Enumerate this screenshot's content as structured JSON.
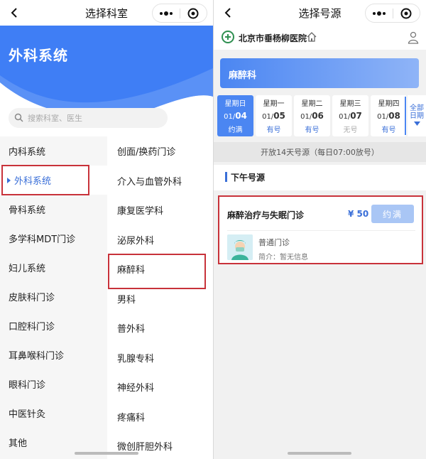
{
  "left": {
    "nav_title": "选择科室",
    "hero_title": "外科系统",
    "search_placeholder": "搜索科室、医生",
    "categories": [
      "内科系统",
      "外科系统",
      "骨科系统",
      "多学科MDT门诊",
      "妇儿系统",
      "皮肤科门诊",
      "口腔科门诊",
      "耳鼻喉科门诊",
      "眼科门诊",
      "中医针灸",
      "其他"
    ],
    "subdepartments": [
      "创面/换药门诊",
      "介入与血管外科",
      "康复医学科",
      "泌尿外科",
      "麻醉科",
      "男科",
      "普外科",
      "乳腺专科",
      "神经外科",
      "疼痛科",
      "微创肝胆外科"
    ]
  },
  "right": {
    "nav_title": "选择号源",
    "hospital_name": "北京市垂杨柳医院",
    "dept_name": "麻醉科",
    "dates": [
      {
        "weekday": "星期日",
        "month": "01/",
        "day": "04",
        "status": "约满"
      },
      {
        "weekday": "星期一",
        "month": "01/",
        "day": "05",
        "status": "有号"
      },
      {
        "weekday": "星期二",
        "month": "01/",
        "day": "06",
        "status": "有号"
      },
      {
        "weekday": "星期三",
        "month": "01/",
        "day": "07",
        "status": "无号"
      },
      {
        "weekday": "星期四",
        "month": "01/",
        "day": "08",
        "status": "有号"
      }
    ],
    "all_dates_label_1": "全部",
    "all_dates_label_2": "日期",
    "notice": "开放14天号源（每日07:00放号）",
    "section_title": "下午号源",
    "doctor_card": {
      "title": "麻醉治疗与失眠门诊",
      "price": "¥ 50",
      "button": "约满",
      "type": "普通门诊",
      "intro": "简介：暂无信息"
    }
  },
  "colors": {
    "accent": "#3a6fd8",
    "hero": "#3f7ef5",
    "highlight": "#c8323a"
  }
}
